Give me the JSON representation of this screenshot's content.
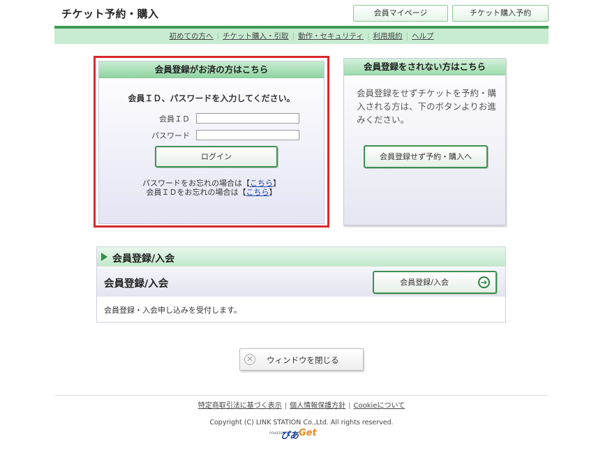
{
  "header": {
    "title": "チケット予約・購入",
    "mypage_label": "会員マイページ",
    "ticket_label": "チケット購入予約"
  },
  "nav": {
    "items": [
      "初めての方へ",
      "チケット購入・引取",
      "動作・セキュリティ",
      "利用規約",
      "ヘルプ"
    ],
    "separator": "|"
  },
  "login": {
    "heading": "会員登録がお済の方はこちら",
    "instruction": "会員ＩＤ、パスワードを入力してください。",
    "id_label": "会員ＩＤ",
    "id_value": "",
    "pw_label": "パスワード",
    "pw_value": "",
    "button_label": "ログイン",
    "forgot_pw_prefix": "パスワードをお忘れの場合は【",
    "forgot_id_prefix": "会員ＩＤをお忘れの場合は【",
    "forgot_link": "こちら",
    "forgot_suffix": "】"
  },
  "guest": {
    "heading": "会員登録をされない方はこちら",
    "text": "会員登録をせずチケットを予約・購入される方は、下のボタンよりお進みください。",
    "button_label": "会員登録せず予約・購入へ"
  },
  "registration": {
    "heading": "会員登録/入会",
    "subheading": "会員登録/入会",
    "button_label": "会員登録/入会",
    "button_icon": "arrow-right-circle-icon",
    "description": "会員登録・入会申し込みを受付します。"
  },
  "close_window": {
    "label": "ウィンドウを閉じる",
    "icon": "close-circle-icon"
  },
  "footer": {
    "links": [
      "特定商取引法に基づく表示",
      "個人情報保護方針",
      "Cookieについて"
    ],
    "separator": "|",
    "copyright": "Copyright (C) LINK STATION Co.,Ltd. All rights reserved.",
    "powered_by": "POWERED BY",
    "logo_pia": "ぴあ",
    "logo_get": "Get"
  },
  "colors": {
    "brand_green": "#3f9a55",
    "highlight_red": "#d8272f",
    "link_blue": "#1a44aa"
  }
}
